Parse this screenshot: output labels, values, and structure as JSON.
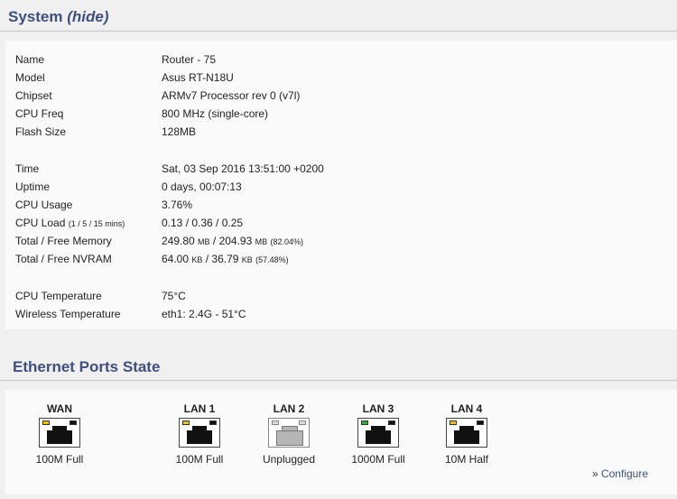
{
  "system": {
    "title": "System",
    "hide_link": "(hide)",
    "rows1": [
      {
        "label": "Name",
        "value": "Router - 75"
      },
      {
        "label": "Model",
        "value": "Asus RT-N18U"
      },
      {
        "label": "Chipset",
        "value": "ARMv7 Processor rev 0 (v7l)"
      },
      {
        "label": "CPU Freq",
        "value": "800 MHz (single-core)"
      },
      {
        "label": "Flash Size",
        "value": "128MB"
      }
    ],
    "time": {
      "label": "Time",
      "value": "Sat, 03 Sep 2016 13:51:00 +0200"
    },
    "uptime": {
      "label": "Uptime",
      "value": "0 days, 00:07:13"
    },
    "cpu_usage": {
      "label": "CPU Usage",
      "value": "3.76%"
    },
    "cpu_load": {
      "label": "CPU Load",
      "label_small": "(1 / 5 / 15 mins)",
      "value": "0.13 / 0.36 / 0.25"
    },
    "memory": {
      "label": "Total / Free Memory",
      "total": "249.80",
      "total_unit": "MB",
      "sep": " / ",
      "free": "204.93",
      "free_unit": "MB",
      "pct": "(82.04%)"
    },
    "nvram": {
      "label": "Total / Free NVRAM",
      "total": "64.00",
      "total_unit": "KB",
      "sep": " / ",
      "free": "36.79",
      "free_unit": "KB",
      "pct": "(57.48%)"
    },
    "cpu_temp": {
      "label": "CPU Temperature",
      "value": "75°C"
    },
    "wireless_temp": {
      "label": "Wireless Temperature",
      "value": "eth1: 2.4G - 51°C"
    }
  },
  "ethernet": {
    "title": "Ethernet Ports State",
    "ports": [
      {
        "name": "WAN",
        "status": "100M Full",
        "led_color": "#f5c400",
        "connected": true
      },
      {
        "name": "LAN 1",
        "status": "100M Full",
        "led_color": "#f5c400",
        "connected": true
      },
      {
        "name": "LAN 2",
        "status": "Unplugged",
        "led_color": "#dcdcdc",
        "connected": false
      },
      {
        "name": "LAN 3",
        "status": "1000M Full",
        "led_color": "#3bb33b",
        "connected": true
      },
      {
        "name": "LAN 4",
        "status": "10M Half",
        "led_color": "#f5c400",
        "connected": true
      }
    ],
    "configure_prefix": "»",
    "configure_label": "Configure"
  }
}
